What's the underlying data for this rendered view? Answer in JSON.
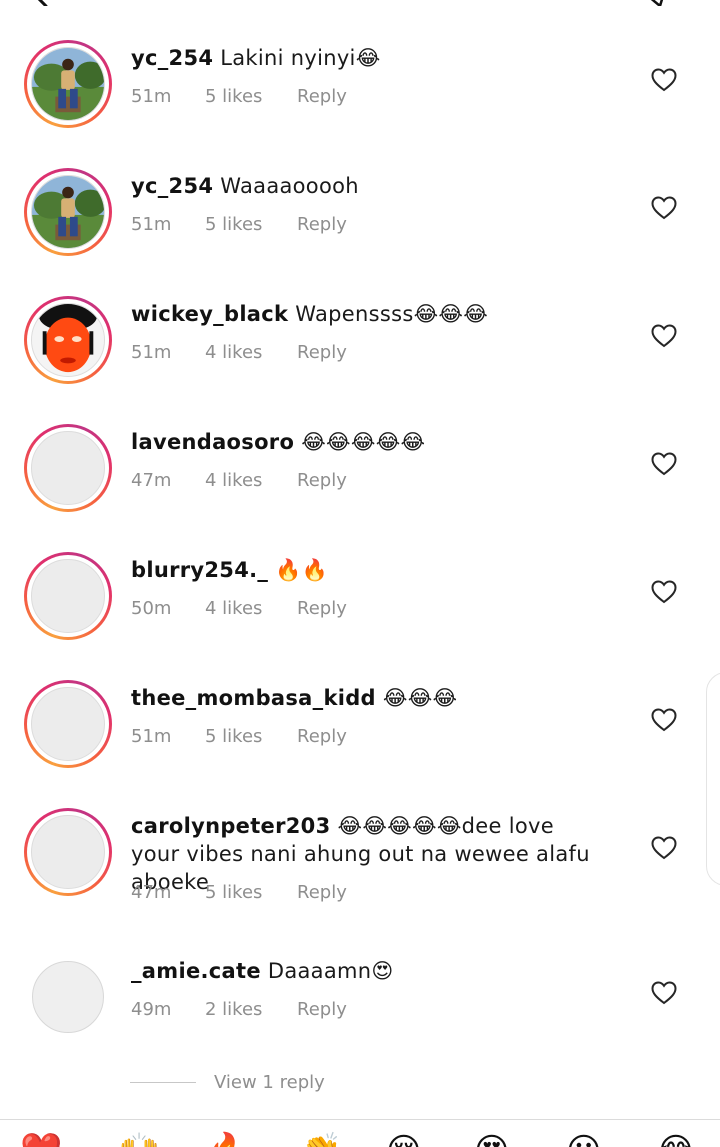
{
  "comments": [
    {
      "username": "yc_254",
      "text": "Lakini nyinyi😂",
      "time": "51m",
      "likes": "5 likes",
      "reply": "Reply",
      "avatar": "photo-person-sitting"
    },
    {
      "username": "yc_254",
      "text": "Waaaaooooh",
      "time": "51m",
      "likes": "5 likes",
      "reply": "Reply",
      "avatar": "photo-person-sitting"
    },
    {
      "username": "wickey_black",
      "text": "Wapenssss😂😂😂",
      "time": "51m",
      "likes": "4 likes",
      "reply": "Reply",
      "avatar": "photo-face-orange"
    },
    {
      "username": "lavendaosoro",
      "text": "😂😂😂😂😂",
      "time": "47m",
      "likes": "4 likes",
      "reply": "Reply",
      "avatar": "default"
    },
    {
      "username": "blurry254._",
      "text": "🔥🔥",
      "time": "50m",
      "likes": "4 likes",
      "reply": "Reply",
      "avatar": "default"
    },
    {
      "username": "thee_mombasa_kidd",
      "text": "😂😂😂",
      "time": "51m",
      "likes": "5 likes",
      "reply": "Reply",
      "avatar": "default"
    },
    {
      "username": "carolynpeter203",
      "text": "😂😂😂😂😂dee love your vibes nani ahung out na wewee alafu aboeke",
      "time": "47m",
      "likes": "5 likes",
      "reply": "Reply",
      "avatar": "default"
    },
    {
      "username": "_amie.cate",
      "text": "Daaaamn😍",
      "time": "49m",
      "likes": "2 likes",
      "reply": "Reply",
      "avatar": "default-no-story"
    }
  ],
  "view_replies": "View 1 reply",
  "icons": {
    "like": "heart-outline-icon",
    "back": "back-arrow-icon",
    "share": "send-icon"
  },
  "colors": {
    "story_ring_start": "#f9a03f",
    "story_ring_end": "#c13584",
    "meta_text": "#8e8e8e"
  },
  "emoji_bar": [
    "❤️",
    "🙌",
    "🔥",
    "👏",
    "😢",
    "😍",
    "😮",
    "😂"
  ]
}
